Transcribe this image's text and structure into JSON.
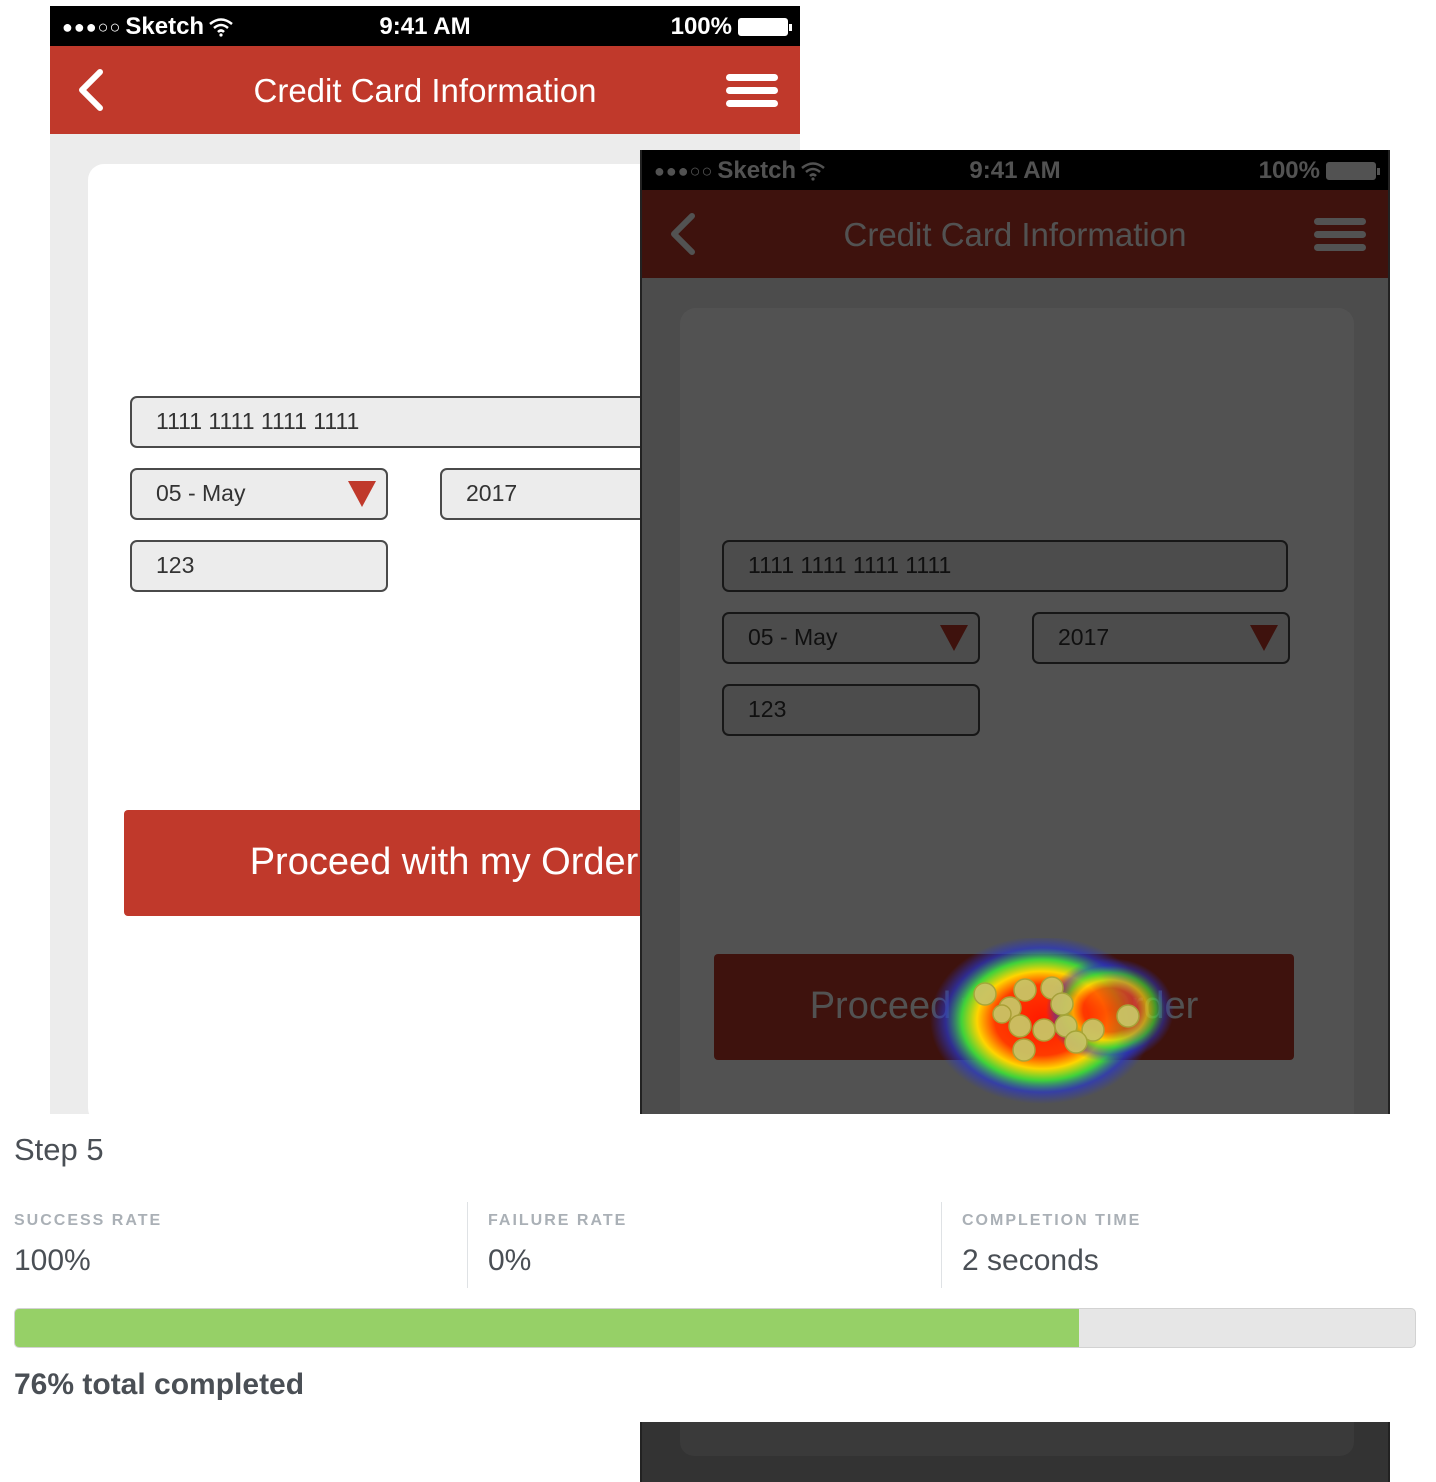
{
  "phone": {
    "carrier": "Sketch",
    "signal_dots": "●●●○○",
    "time": "9:41 AM",
    "battery": "100%",
    "nav_title": "Credit Card Information",
    "card_number": "1111 1111 1111 1111",
    "expiry_month": "05 - May",
    "expiry_year": "2017",
    "cvv": "123",
    "order_button": "Proceed with my Order",
    "icons": [
      "wifi-icon",
      "battery-icon",
      "back-chevron-icon",
      "hamburger-menu-icon",
      "dropdown-caret-icon"
    ]
  },
  "colors": {
    "brand_red": "#c0392b",
    "progress_green": "#96d067"
  },
  "step": {
    "title": "Step 5",
    "metrics": [
      {
        "label": "SUCCESS RATE",
        "value": "100%"
      },
      {
        "label": "FAILURE RATE",
        "value": "0%"
      },
      {
        "label": "COMPLETION TIME",
        "value": "2 seconds"
      }
    ],
    "progress_percent": 76,
    "progress_text": "76% total completed"
  }
}
